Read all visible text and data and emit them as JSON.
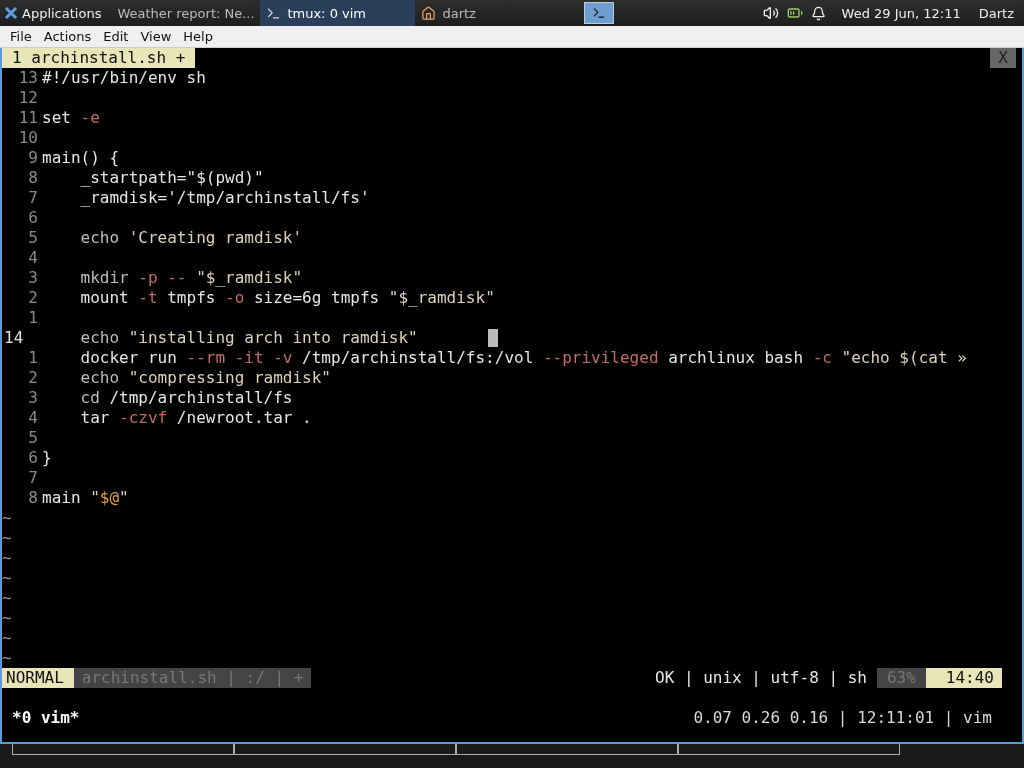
{
  "taskbar": {
    "apps_label": "Applications",
    "tasks": [
      {
        "label": "Weather report: Ne...",
        "kind": "browser",
        "selected": false
      },
      {
        "label": "tmux: 0 vim",
        "kind": "terminal",
        "selected": true
      },
      {
        "label": "dartz",
        "kind": "folder",
        "selected": false
      }
    ],
    "launcher_selected": true,
    "clock": "Wed 29 Jun, 12:11",
    "user": "Dartz"
  },
  "menu": [
    "File",
    "Actions",
    "Edit",
    "View",
    "Help"
  ],
  "vim": {
    "tab": {
      "label": "1 archinstall.sh +",
      "selected": true
    },
    "close": "X",
    "lines": [
      {
        "number": "13",
        "current": false,
        "segments": [
          {
            "kind": "plain",
            "text": "#!/usr/bin/env sh"
          }
        ]
      },
      {
        "number": "12",
        "current": false
      },
      {
        "number": "11",
        "current": false,
        "segments": [
          {
            "kind": "plain",
            "text": "set "
          },
          {
            "kind": "flag",
            "text": "-e"
          }
        ]
      },
      {
        "number": "10",
        "current": false
      },
      {
        "number": "9",
        "current": false,
        "segments": [
          {
            "kind": "plain",
            "text": "main() {"
          }
        ]
      },
      {
        "number": "8",
        "current": false,
        "segments": [
          {
            "kind": "plain",
            "text": "    _startpath=\"$(pwd)\""
          }
        ]
      },
      {
        "number": "7",
        "current": false,
        "segments": [
          {
            "kind": "plain",
            "text": "    _ramdisk='/tmp/archinstall/fs'"
          }
        ]
      },
      {
        "number": "6",
        "current": false
      },
      {
        "number": "5",
        "current": false,
        "segments": [
          {
            "kind": "cmd",
            "text": "    echo "
          },
          {
            "kind": "str",
            "text": "'Creating ramdisk'"
          }
        ]
      },
      {
        "number": "4",
        "current": false
      },
      {
        "number": "3",
        "current": false,
        "segments": [
          {
            "kind": "cmd",
            "text": "    mkdir "
          },
          {
            "kind": "flag",
            "text": "-p -- "
          },
          {
            "kind": "str",
            "text": "\"$_ramdisk\""
          }
        ]
      },
      {
        "number": "2",
        "current": false,
        "segments": [
          {
            "kind": "plain",
            "text": "    mount "
          },
          {
            "kind": "flag",
            "text": "-t "
          },
          {
            "kind": "plain",
            "text": "tmpfs "
          },
          {
            "kind": "flag",
            "text": "-o "
          },
          {
            "kind": "plain",
            "text": "size=6g tmpfs "
          },
          {
            "kind": "str",
            "text": "\"$_ramdisk\""
          }
        ]
      },
      {
        "number": "1",
        "current": false
      },
      {
        "number": "14",
        "current": true,
        "segments": [
          {
            "kind": "cmd",
            "text": "    echo "
          },
          {
            "kind": "str",
            "text": "\"installing arch into ramdisk\""
          }
        ]
      },
      {
        "number": "1",
        "current": false,
        "segments": [
          {
            "kind": "plain",
            "text": "    docker run "
          },
          {
            "kind": "flag",
            "text": "--rm -it -v "
          },
          {
            "kind": "plain",
            "text": "/tmp/archinstall/fs:/vol "
          },
          {
            "kind": "flag",
            "text": "--privileged "
          },
          {
            "kind": "plain",
            "text": "archlinux bash "
          },
          {
            "kind": "flag",
            "text": "-c "
          },
          {
            "kind": "str",
            "text": "\"echo $(cat »"
          }
        ]
      },
      {
        "number": "2",
        "current": false,
        "segments": [
          {
            "kind": "cmd",
            "text": "    echo "
          },
          {
            "kind": "str",
            "text": "\"compressing ramdisk\""
          }
        ]
      },
      {
        "number": "3",
        "current": false,
        "segments": [
          {
            "kind": "cmd",
            "text": "    cd "
          },
          {
            "kind": "plain",
            "text": "/tmp/archinstall/fs"
          }
        ]
      },
      {
        "number": "4",
        "current": false,
        "segments": [
          {
            "kind": "plain",
            "text": "    tar "
          },
          {
            "kind": "flag",
            "text": "-czvf "
          },
          {
            "kind": "plain",
            "text": "/newroot.tar ."
          }
        ]
      },
      {
        "number": "5",
        "current": false
      },
      {
        "number": "6",
        "current": false,
        "segments": [
          {
            "kind": "plain",
            "text": "}"
          }
        ]
      },
      {
        "number": "7",
        "current": false
      },
      {
        "number": "8",
        "current": false,
        "segments": [
          {
            "kind": "plain",
            "text": "main "
          },
          {
            "kind": "str",
            "text": "\""
          },
          {
            "kind": "var",
            "text": "$@"
          },
          {
            "kind": "str",
            "text": "\""
          }
        ]
      }
    ],
    "filler": [
      "~",
      "~",
      "~",
      "~",
      "~",
      "~",
      "~",
      "~"
    ],
    "status": {
      "mode": "NORMAL",
      "file": "archinstall.sh | :/ | +",
      "info": "OK | unix | utf-8 | sh",
      "percent": "63%",
      "position": "14:40"
    }
  },
  "tmux": {
    "window": "*0 vim*",
    "right": "0.07 0.26 0.16 | 12:11:01 | vim"
  }
}
